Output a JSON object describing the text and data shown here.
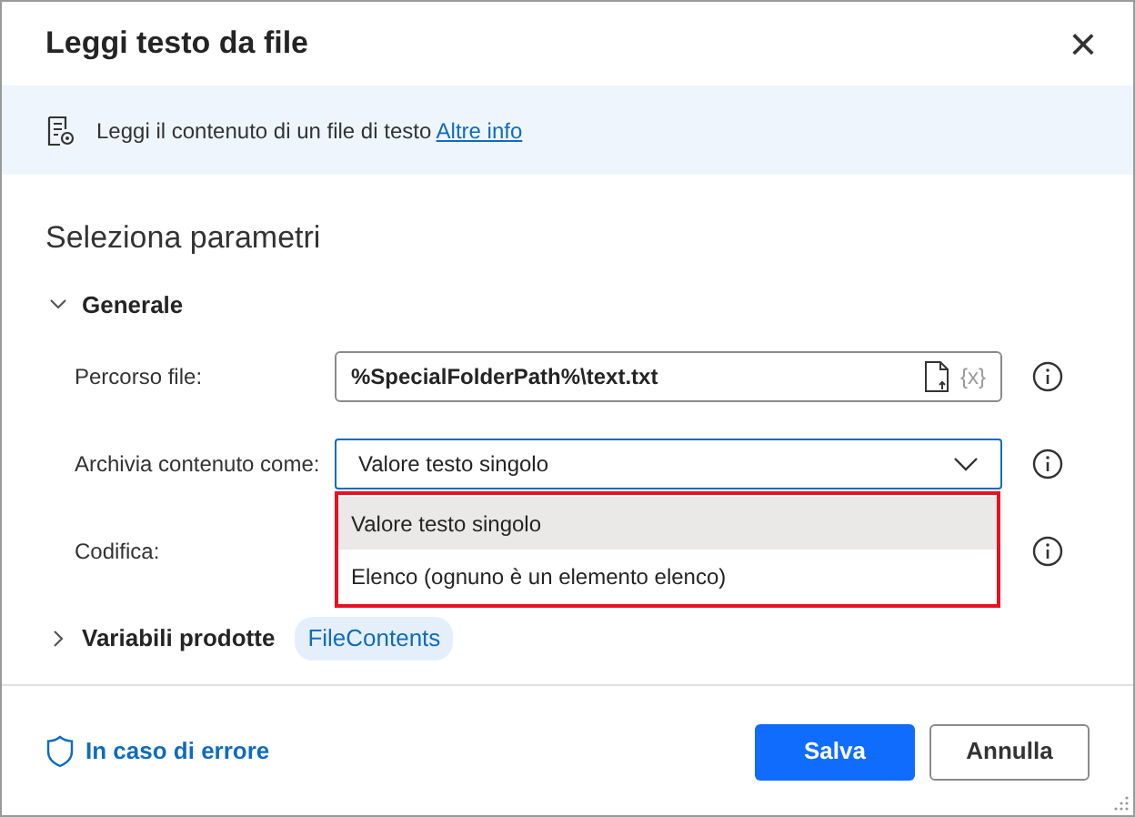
{
  "window": {
    "title": "Leggi testo da file",
    "close": "×"
  },
  "banner": {
    "text": "Leggi il contenuto di un file di testo",
    "link": "Altre info"
  },
  "section_title": "Seleziona parametri",
  "group": {
    "label": "Generale",
    "expanded": true
  },
  "fields": [
    {
      "kind": "text",
      "label": "Percorso file:",
      "value": "%SpecialFolderPath%\\text.txt",
      "variable_hint": "{x}"
    },
    {
      "kind": "select",
      "label": "Archivia contenuto come:",
      "value": "Valore testo singolo",
      "open": true,
      "options": [
        {
          "label": "Valore testo singolo",
          "selected": true
        },
        {
          "label": "Elenco (ognuno è un elemento elenco)",
          "selected": false
        }
      ]
    },
    {
      "kind": "covered",
      "label": "Codifica:"
    }
  ],
  "produced": {
    "label": "Variabili prodotte",
    "expanded": false,
    "variables": [
      "FileContents"
    ]
  },
  "footer": {
    "error_link": "In caso di errore",
    "buttons": [
      {
        "label": "Salva",
        "primary": true
      },
      {
        "label": "Annulla",
        "primary": false
      }
    ]
  }
}
